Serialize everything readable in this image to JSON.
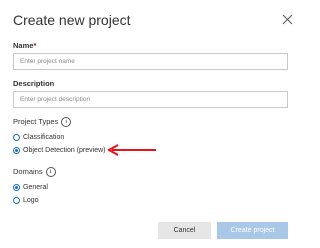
{
  "dialog": {
    "title": "Create new project",
    "close_icon": "close-icon"
  },
  "name_field": {
    "label": "Name",
    "required_mark": "*",
    "value": "",
    "placeholder": "Enter project name"
  },
  "description_field": {
    "label": "Description",
    "value": "",
    "placeholder": "Enter project description"
  },
  "project_types": {
    "label": "Project Types",
    "info_icon": "info-icon",
    "info_glyph": "i",
    "options": [
      {
        "label": "Classification",
        "selected": false
      },
      {
        "label": "Object Detection (preview)",
        "selected": true
      }
    ]
  },
  "domains": {
    "label": "Domains",
    "info_icon": "info-icon",
    "info_glyph": "i",
    "options": [
      {
        "label": "General",
        "selected": true
      },
      {
        "label": "Logo",
        "selected": false
      }
    ]
  },
  "annotation": {
    "arrow_icon": "left-arrow-icon",
    "color": "#e8141c"
  },
  "buttons": {
    "cancel_label": "Cancel",
    "create_label": "Create project"
  },
  "colors": {
    "accent": "#1f6fb5",
    "create_button_bg": "#a9c7e6",
    "cancel_button_bg": "#e6e6e6",
    "required": "#c00000"
  }
}
